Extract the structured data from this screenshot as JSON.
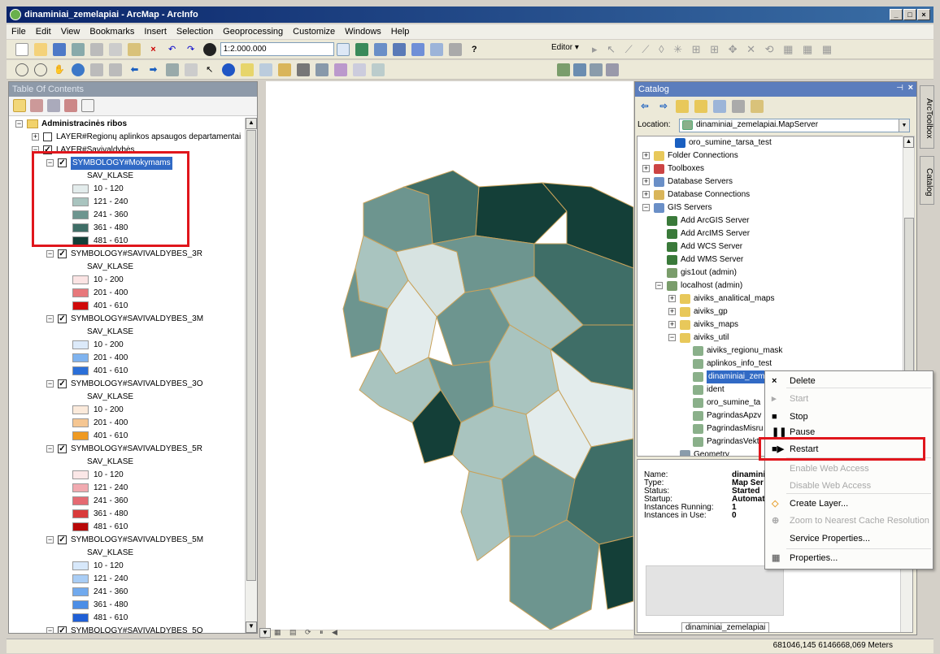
{
  "window": {
    "title": "dinaminiai_zemelapiai - ArcMap - ArcInfo"
  },
  "menu": [
    "File",
    "Edit",
    "View",
    "Bookmarks",
    "Insert",
    "Selection",
    "Geoprocessing",
    "Customize",
    "Windows",
    "Help"
  ],
  "toolbar": {
    "scale": "1:2.000.000",
    "editor_label": "Editor ▾"
  },
  "toc": {
    "title": "Table Of Contents",
    "root": "Administracinės ribos",
    "layer1": "LAYER#Regionų aplinkos apsaugos departamentai",
    "layer2": "LAYER#Savivaldybės",
    "groups": [
      {
        "name": "SYMBOLOGY#Mokymams",
        "field": "SAV_KLASE",
        "classes": [
          {
            "label": "10 - 120",
            "color": "#e3ecec"
          },
          {
            "label": "121 - 240",
            "color": "#a9c4bf"
          },
          {
            "label": "241 - 360",
            "color": "#6d958f"
          },
          {
            "label": "361 - 480",
            "color": "#3f6e67"
          },
          {
            "label": "481 - 610",
            "color": "#143f38"
          }
        ]
      },
      {
        "name": "SYMBOLOGY#SAVIVALDYBES_3R",
        "field": "SAV_KLASE",
        "classes": [
          {
            "label": "10 - 200",
            "color": "#fbe4e4"
          },
          {
            "label": "201 - 400",
            "color": "#e7787b"
          },
          {
            "label": "401 - 610",
            "color": "#d00a0a"
          }
        ]
      },
      {
        "name": "SYMBOLOGY#SAVIVALDYBES_3M",
        "field": "SAV_KLASE",
        "classes": [
          {
            "label": "10 - 200",
            "color": "#dceafa"
          },
          {
            "label": "201 - 400",
            "color": "#7fb3ef"
          },
          {
            "label": "401 - 610",
            "color": "#2b6fd8"
          }
        ]
      },
      {
        "name": "SYMBOLOGY#SAVIVALDYBES_3O",
        "field": "SAV_KLASE",
        "classes": [
          {
            "label": "10 - 200",
            "color": "#fbeadb"
          },
          {
            "label": "201 - 400",
            "color": "#f5c692"
          },
          {
            "label": "401 - 610",
            "color": "#ef9a22"
          }
        ]
      },
      {
        "name": "SYMBOLOGY#SAVIVALDYBES_5R",
        "field": "SAV_KLASE",
        "classes": [
          {
            "label": "10 - 120",
            "color": "#fbe7e7"
          },
          {
            "label": "121 - 240",
            "color": "#f1aab0"
          },
          {
            "label": "241 - 360",
            "color": "#e56a72"
          },
          {
            "label": "361 - 480",
            "color": "#d93a3a"
          },
          {
            "label": "481 - 610",
            "color": "#b80808"
          }
        ]
      },
      {
        "name": "SYMBOLOGY#SAVIVALDYBES_5M",
        "field": "SAV_KLASE",
        "classes": [
          {
            "label": "10 - 120",
            "color": "#d7e8fb"
          },
          {
            "label": "121 - 240",
            "color": "#a9cdf5"
          },
          {
            "label": "241 - 360",
            "color": "#71aaee"
          },
          {
            "label": "361 - 480",
            "color": "#4c8ee6"
          },
          {
            "label": "481 - 610",
            "color": "#1f5fd6"
          }
        ]
      },
      {
        "name": "SYMBOLOGY#SAVIVALDYBES_5O",
        "field": "SAV_KLASE",
        "classes": []
      }
    ]
  },
  "catalog": {
    "title": "Catalog",
    "location_label": "Location:",
    "location_value": "dinaminiai_zemelapiai.MapServer",
    "tree": [
      "oro_sumine_tarsa_test",
      "Folder Connections",
      "Toolboxes",
      "Database Servers",
      "Database Connections",
      "GIS Servers",
      "Add ArcGIS Server",
      "Add ArcIMS Server",
      "Add WCS Server",
      "Add WMS Server",
      "gis1out (admin)",
      "localhost (admin)",
      "aiviks_analitical_maps",
      "aiviks_gp",
      "aiviks_maps",
      "aiviks_util",
      "aiviks_regionu_mask",
      "aplinkos_info_test",
      "dinaminiai_zem",
      "ident",
      "oro_sumine_ta",
      "PagrindasApzv",
      "PagrindasMisru",
      "PagrindasVekt",
      "Geometry"
    ],
    "props": [
      {
        "k": "Name:",
        "v": "dinamini"
      },
      {
        "k": "Type:",
        "v": "Map Ser"
      },
      {
        "k": "Status:",
        "v": "Started"
      },
      {
        "k": "Startup:",
        "v": "Automati"
      },
      {
        "k": "Instances Running:",
        "v": "1"
      },
      {
        "k": "Instances in Use:",
        "v": "0"
      }
    ],
    "preview_tab": "dinaminiai_zemelapiai"
  },
  "context_menu": [
    {
      "label": "Delete",
      "enabled": true
    },
    {
      "label": "Start",
      "enabled": false
    },
    {
      "label": "Stop",
      "enabled": true
    },
    {
      "label": "Pause",
      "enabled": true
    },
    {
      "label": "Restart",
      "enabled": true
    },
    {
      "label": "Enable Web Access",
      "enabled": false
    },
    {
      "label": "Disable Web Access",
      "enabled": false
    },
    {
      "label": "Create Layer...",
      "enabled": true
    },
    {
      "label": "Zoom to Nearest Cache Resolution",
      "enabled": false
    },
    {
      "label": "Service Properties...",
      "enabled": true
    },
    {
      "label": "Properties...",
      "enabled": true
    }
  ],
  "side_tabs": [
    "ArcToolbox",
    "Catalog"
  ],
  "status": {
    "coords": "681046,145  6146668,069 Meters"
  }
}
